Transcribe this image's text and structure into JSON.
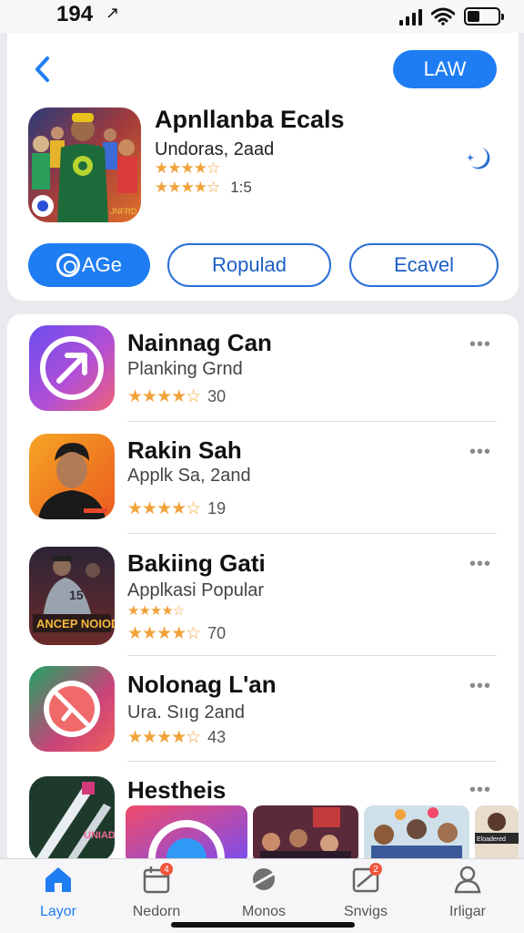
{
  "status": {
    "time": "194",
    "arrow_glyph": "↗"
  },
  "header": {
    "right_button_label": "LAW"
  },
  "hero": {
    "title": "Apnllanba Ecals",
    "subtitle": "Undoras, 2aad",
    "rating_top": "★★★★☆",
    "rating_bottom": "★★★★☆",
    "rating_count": "1:5",
    "buttons": {
      "primary": "AGe",
      "secondary": "Ropulad",
      "tertiary": "Ecavel"
    }
  },
  "apps": [
    {
      "title": "Nainnag Can",
      "subtitle": "Planking Grnd",
      "stars": "★★★★☆",
      "count": "30",
      "more": "•••"
    },
    {
      "title": "Rakin Sah",
      "subtitle": "Applk Sa, 2and",
      "stars": "★★★★☆",
      "count": "19",
      "more": "•••"
    },
    {
      "title": "Bakiing Gati",
      "subtitle": "Applkasi Popular",
      "stars_small": "★★★★☆",
      "stars": "★★★★☆",
      "count": "70",
      "more": "•••"
    },
    {
      "title": "Nolonag L'an",
      "subtitle": "Ura. Sııg 2and",
      "stars": "★★★★☆",
      "count": "43",
      "more": "•••"
    },
    {
      "title": "Hestheis",
      "more": "•••"
    }
  ],
  "icon_text": {
    "game_banner": "ANCEP NOIOD",
    "game_jersey": "15",
    "cricket_label": "UNIAD",
    "hero_badge": "JNFRD",
    "thumb_label": "Eloadered"
  },
  "tabs": [
    {
      "label": "Layor",
      "icon": "home-icon",
      "active": true
    },
    {
      "label": "Nedorn",
      "icon": "calendar-icon",
      "badge": "4"
    },
    {
      "label": "Monos",
      "icon": "planet-icon"
    },
    {
      "label": "Snvigs",
      "icon": "image-icon",
      "badge": "2"
    },
    {
      "label": "Irligar",
      "icon": "person-icon"
    }
  ],
  "colors": {
    "accent": "#1f7df3",
    "star": "#f2a23a",
    "badge": "#f0553b"
  }
}
